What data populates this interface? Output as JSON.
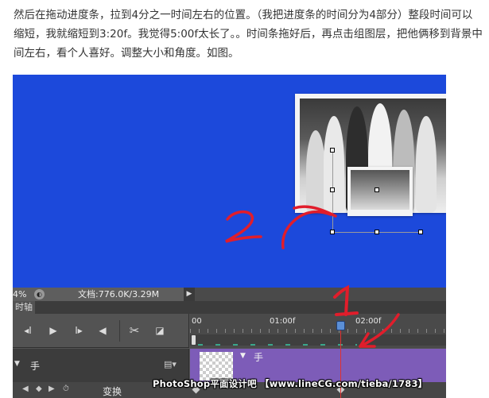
{
  "article": {
    "paragraph": "然后在拖动进度条，拉到4分之一时间左右的位置。（我把进度条的时间分为4部分）整段时间可以缩短，我就缩短到3:20f。我觉得5:00f太长了。。时间条拖好后，再点击组图层，把他俩移到背景中间左右，看个人喜好。调整大小和角度。如图。"
  },
  "statusbar": {
    "zoom": "4%",
    "zoom_icon": "zoom-icon",
    "doc_info": "文档:776.0K/3.29M",
    "arrow": "▶"
  },
  "panel": {
    "tab_label": "时轴"
  },
  "timeline": {
    "controls": {
      "first_frame": "◂I",
      "play": "▶",
      "next_frame": "I▸",
      "audio": "◀",
      "cut": "✂",
      "transition": "◪"
    },
    "ruler": {
      "labels": [
        "00",
        "01:00f",
        "02:00f"
      ]
    },
    "layer": {
      "name": "手",
      "expand": "▼",
      "film_icon": "film-icon"
    },
    "clip": {
      "name": "手",
      "expand": "▼"
    },
    "bottom": {
      "prev_kf": "◀",
      "add_kf": "◆",
      "next_kf": "▶",
      "stopwatch": "⏱",
      "property_label": "变换"
    }
  },
  "annotations": {
    "number_1": "1",
    "number_2": "2"
  },
  "watermark": "PhotoShop平面设计吧 【www.lineCG.com/tieba/1783】",
  "colors": {
    "canvas_blue": "#1c49db",
    "annotation_red": "#e11d2b",
    "clip_purple": "#7d5cb8",
    "panel_dark": "#535353"
  }
}
